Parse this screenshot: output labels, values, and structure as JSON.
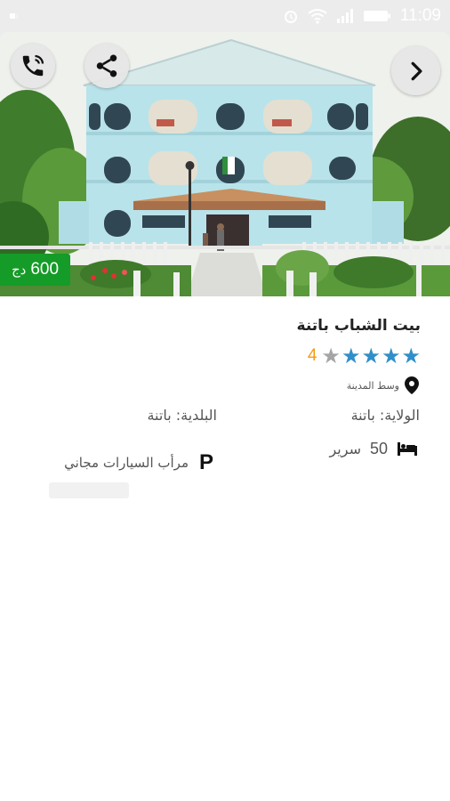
{
  "status_bar": {
    "time": "11:09",
    "icons": [
      "signal-icon",
      "alarm-icon",
      "wifi-icon",
      "cellular-icon",
      "battery-icon"
    ]
  },
  "hero": {
    "image_description_icon": "building-photo",
    "buttons": {
      "call_icon": "phone-icon",
      "share_icon": "share-icon",
      "next_icon": "chevron-right-icon"
    },
    "price": {
      "amount": "600",
      "currency": "دج"
    }
  },
  "details": {
    "title": "بيت الشباب باتنة",
    "rating": {
      "value": "4",
      "stars_filled": 4,
      "stars_total": 5
    },
    "location": "وسط المدينة",
    "wilaya": "الولاية: باتنة",
    "baladiya": "البلدية: باتنة",
    "beds": {
      "count": "50",
      "label": "سرير"
    },
    "parking": {
      "icon_text": "P",
      "label": "مرأب السيارات مجاني"
    }
  },
  "colors": {
    "price_badge": "#159b27",
    "star_filled": "#2f8fc9",
    "star_empty": "#a5a5a5",
    "rating_number": "#f39c12",
    "background": "#ececec",
    "card": "#ffffff"
  }
}
